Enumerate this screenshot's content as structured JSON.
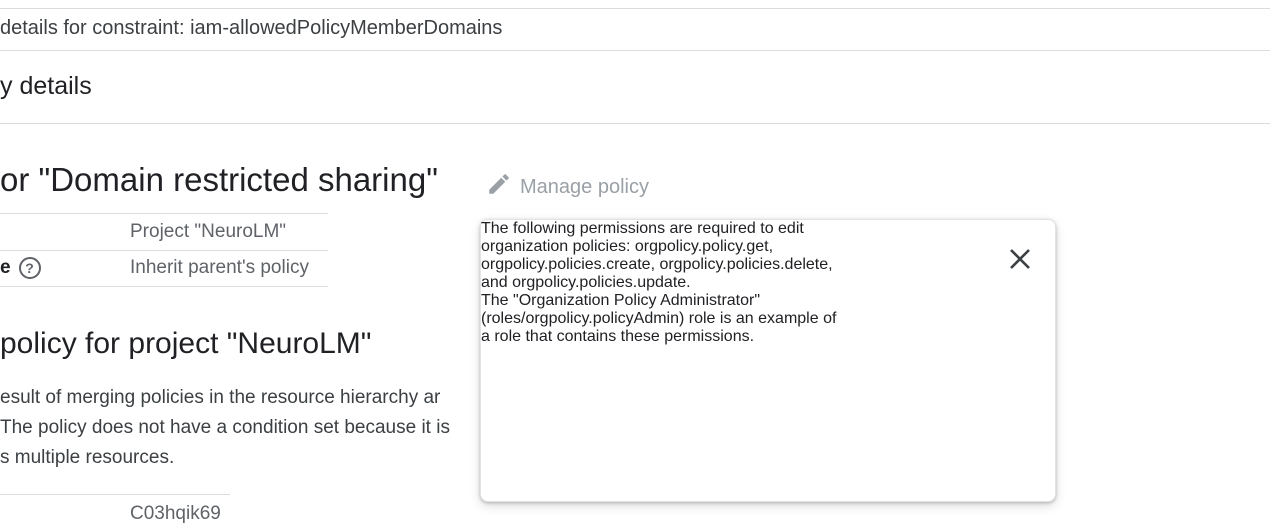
{
  "breadcrumb": "details for constraint: iam-allowedPolicyMemberDomains",
  "section_title": "y details",
  "policy_title": "or \"Domain restricted sharing\"",
  "manage_policy": {
    "label": "Manage policy",
    "icon": "pencil-icon"
  },
  "policy_rows": [
    {
      "key": "",
      "value": "Project \"NeuroLM\""
    },
    {
      "key": "e",
      "value": "Inherit parent's policy",
      "icon": "help-icon",
      "icon_glyph": "?"
    }
  ],
  "effective_title": "policy for project \"NeuroLM\"",
  "description_lines": [
    "esult of merging policies in the resource hierarchy ar",
    "The policy does not have a condition set because it is",
    "s multiple resources."
  ],
  "id_row": {
    "value": "C03hqik69"
  },
  "popup": {
    "paragraph1_lines": [
      "The following permissions are required to edit",
      "organization policies: orgpolicy.policy.get,",
      "orgpolicy.policies.create, orgpolicy.policies.delete,",
      "and orgpolicy.policies.update."
    ],
    "paragraph2_lines": [
      "The \"Organization Policy Administrator\"",
      "(roles/orgpolicy.policyAdmin) role is an example of",
      "a role that contains these permissions."
    ],
    "close_icon": "close-icon"
  }
}
